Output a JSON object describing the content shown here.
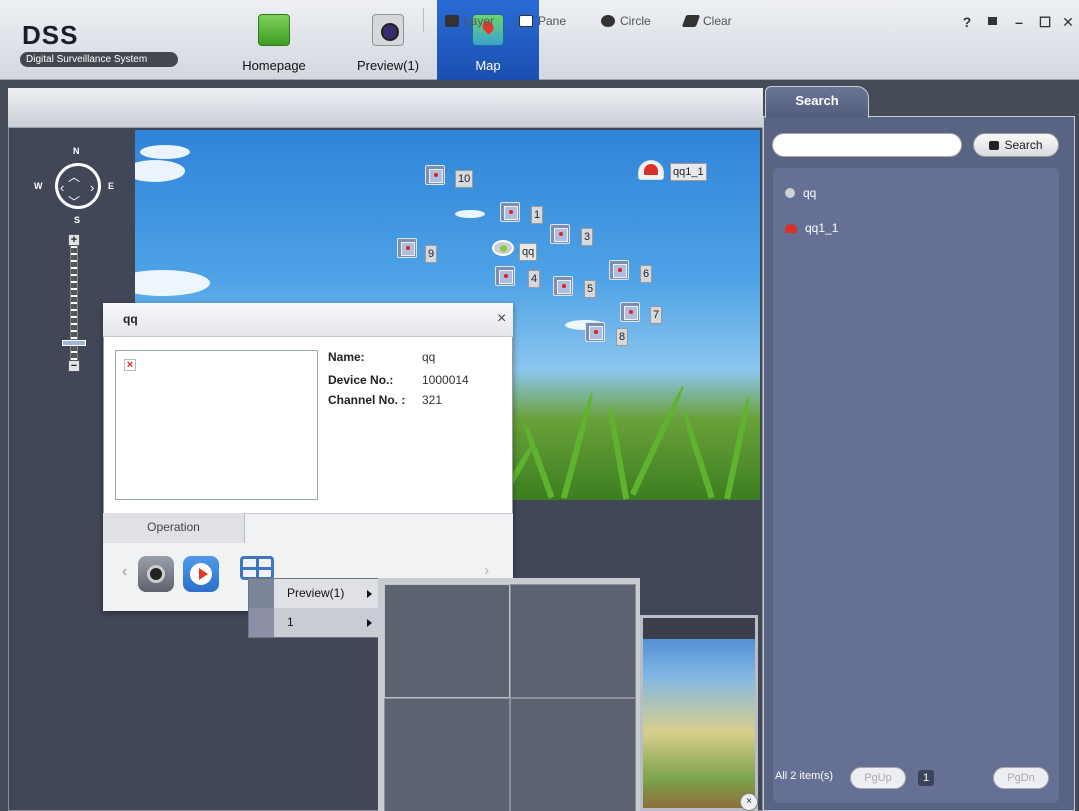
{
  "app": {
    "logo": "DSS",
    "subtitle": "Digital Surveillance System"
  },
  "tabs": {
    "home": "Homepage",
    "preview": "Preview(1)",
    "map": "Map"
  },
  "window_controls": {
    "help": "?",
    "lock": "🔒",
    "minimize": "–",
    "maximize": "☐",
    "close": "✕"
  },
  "toolbar": {
    "layer": "Layer",
    "pane": "Pane",
    "circle": "Circle",
    "clear": "Clear"
  },
  "compass": {
    "n": "N",
    "s": "S",
    "e": "E",
    "w": "W",
    "zoom_in": "+",
    "zoom_out": "−"
  },
  "map_markers": {
    "m10": "10",
    "m1": "1",
    "m3": "3",
    "m9": "9",
    "m4": "4",
    "m5": "5",
    "m6": "6",
    "m7": "7",
    "m8": "8",
    "qq": "qq",
    "qq1_1": "qq1_1"
  },
  "popup": {
    "title": "qq",
    "close": "×",
    "name_label": "Name:",
    "name_value": "qq",
    "device_label": "Device No.:",
    "device_value": "1000014",
    "channel_label": "Channel No. :",
    "channel_value": "321",
    "operation_tab": "Operation",
    "prev": "‹",
    "next": "›"
  },
  "context_menu": {
    "item1": "Preview(1)",
    "item2": "1"
  },
  "search": {
    "tab": "Search",
    "placeholder": "",
    "button": "Search",
    "results": [
      "qq",
      "qq1_1"
    ]
  },
  "pager": {
    "summary": "All 2 item(s)",
    "pgup": "PgUp",
    "page": "1",
    "pgdn": "PgDn"
  },
  "colors": {
    "map_tab": "#2b6bd6",
    "panel": "#596382",
    "alarm_red": "#d9302a",
    "camera_gray": "#7b7f8a"
  }
}
